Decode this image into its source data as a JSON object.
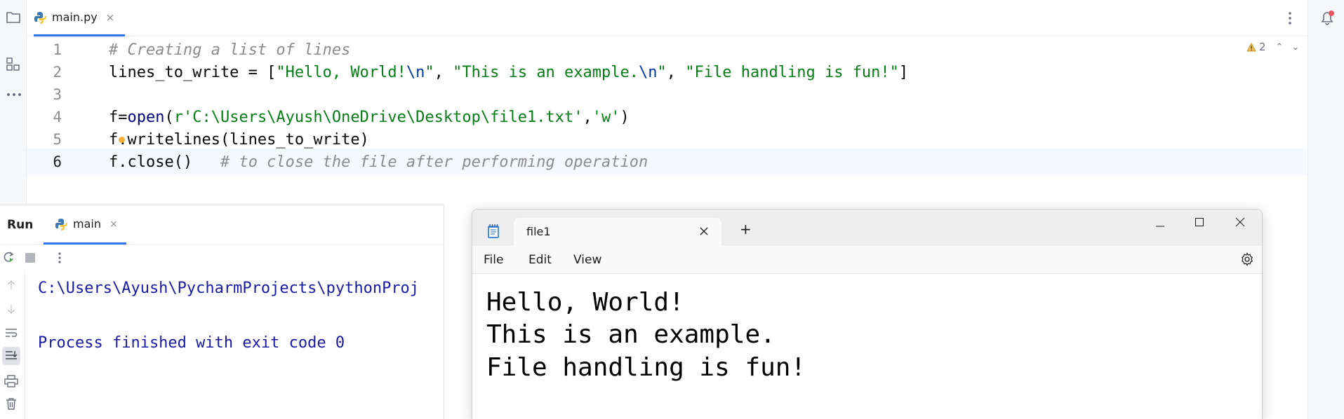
{
  "editor": {
    "tab": {
      "filename": "main.py",
      "close": "×"
    },
    "warnings": {
      "count": "2"
    },
    "lines": [
      {
        "num": "1",
        "comment": "# Creating a list of lines"
      },
      {
        "num": "2",
        "text_a": "lines_to_write = [",
        "str1": "\"Hello, World!",
        "esc1": "\\n",
        "str1_end": "\"",
        "sep1": ", ",
        "str2": "\"This is an example.",
        "esc2": "\\n",
        "str2_end": "\"",
        "sep2": ", ",
        "str3": "\"File handling is fun!\"",
        "text_b": "]"
      },
      {
        "num": "3"
      },
      {
        "num": "4",
        "text_a": "f=",
        "fn": "open",
        "paren": "(",
        "str": "r'C:\\Users\\Ayush\\OneDrive\\Desktop\\file1.txt'",
        "comma": ",",
        "str2": "'w'",
        "close": ")"
      },
      {
        "num": "5",
        "text_a": "f.writelines(lines_to_write)"
      },
      {
        "num": "6",
        "text_a": "f.close()   ",
        "comment": "# to close the file after performing operation"
      }
    ]
  },
  "run": {
    "title": "Run",
    "tab_label": "main",
    "tab_close": "×",
    "console": [
      "C:\\Users\\Ayush\\PycharmProjects\\pythonProj",
      "Process finished with exit code 0"
    ]
  },
  "notepad": {
    "tab_title": "file1",
    "new_tab": "+",
    "menu": [
      "File",
      "Edit",
      "View"
    ],
    "content": [
      "Hello, World!",
      "This is an example.",
      "File handling is fun!"
    ]
  },
  "colors": {
    "accent": "#3574f0",
    "string": "#067d17",
    "comment": "#8c8c8c",
    "console": "#1a1aa6"
  }
}
